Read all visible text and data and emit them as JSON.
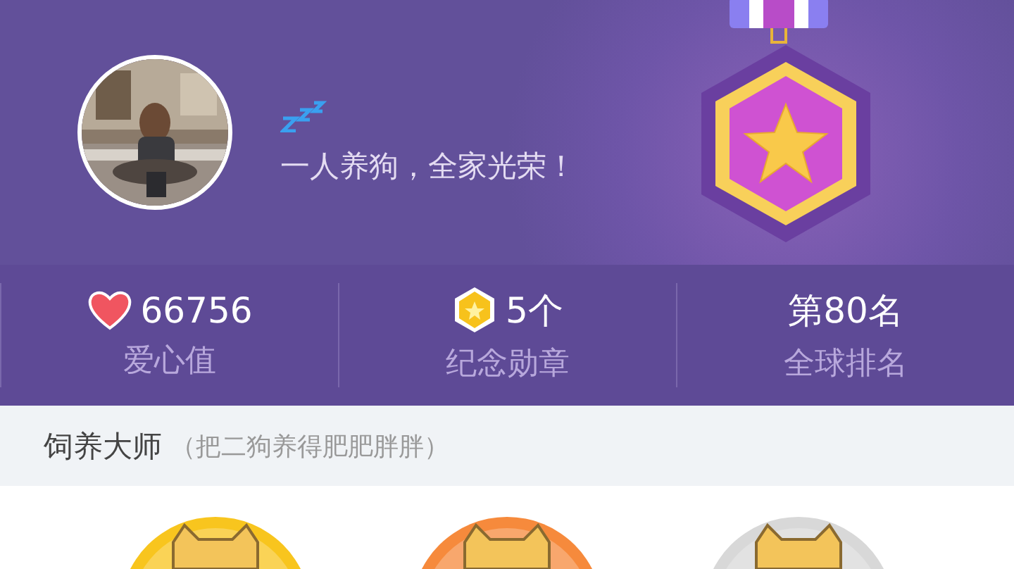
{
  "profile": {
    "motto": "一人养狗，全家光荣！"
  },
  "stats": [
    {
      "kind": "heart",
      "value": "66756",
      "label": "爱心值"
    },
    {
      "kind": "badge",
      "value": "5个",
      "label": "纪念勋章"
    },
    {
      "kind": "plain",
      "value": "第80名",
      "label": "全球排名"
    }
  ],
  "section": {
    "title": "饲养大师",
    "subtitle": "（把二狗养得肥肥胖胖）"
  },
  "badges": [
    {
      "color": "#f8c51e"
    },
    {
      "color": "#f68a3c"
    },
    {
      "color": "#d8d8d8"
    }
  ]
}
